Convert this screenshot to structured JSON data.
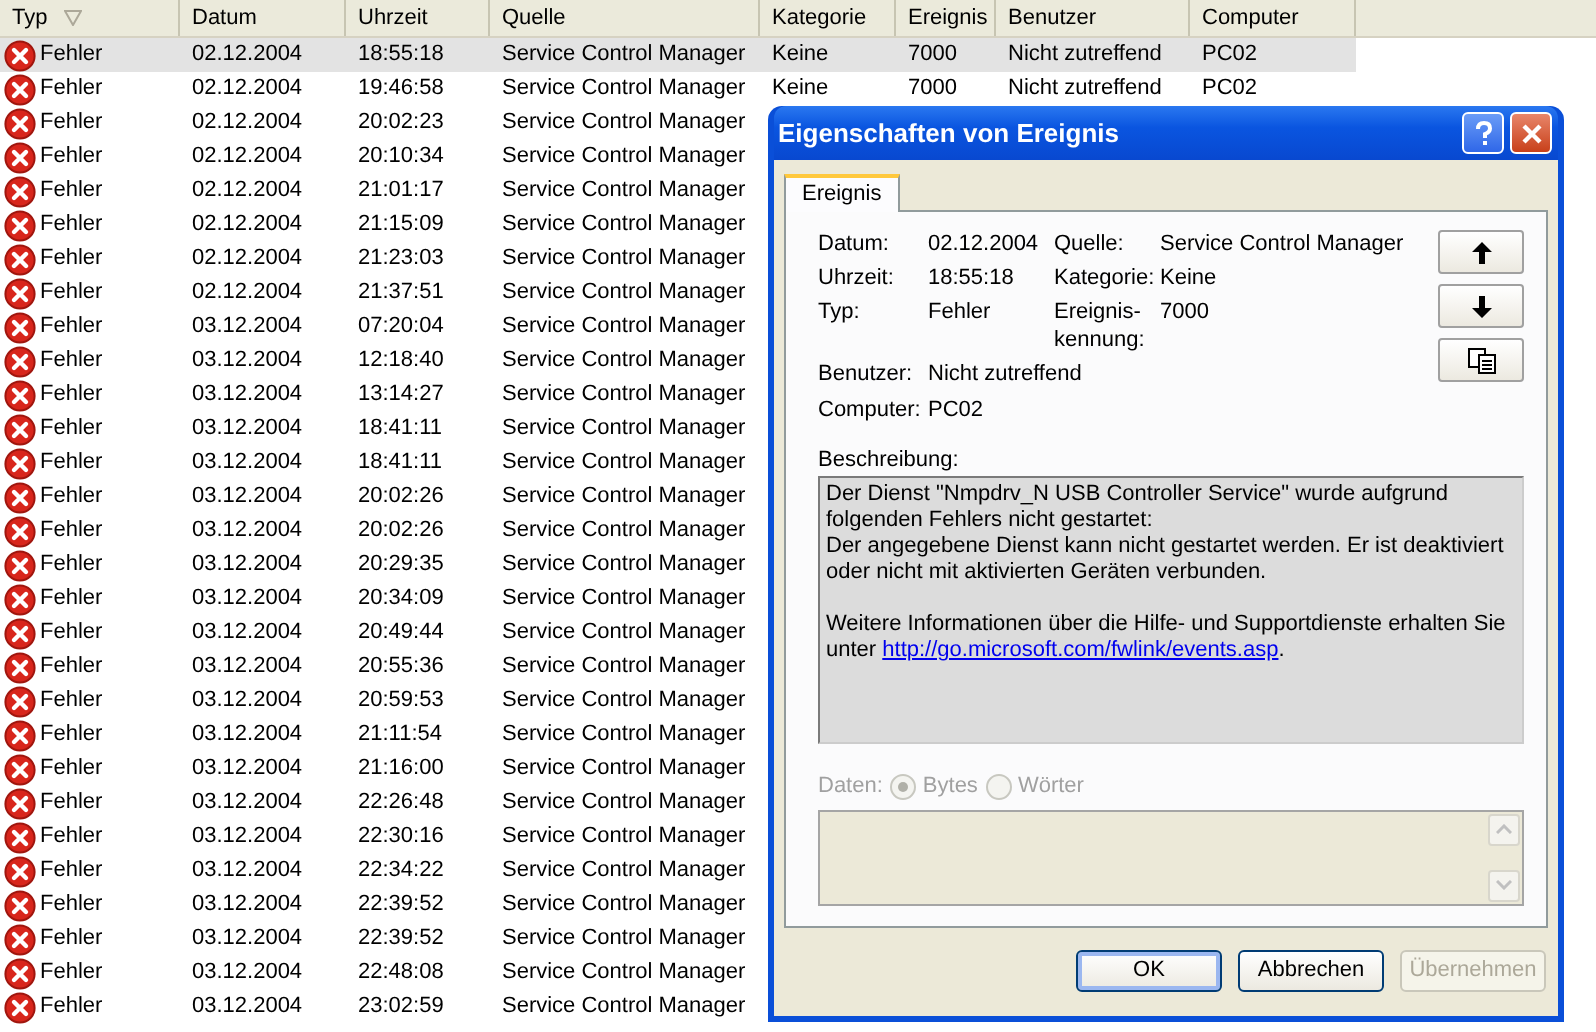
{
  "list": {
    "columns": [
      {
        "label": "Typ",
        "sorted": true
      },
      {
        "label": "Datum",
        "sorted": false
      },
      {
        "label": "Uhrzeit",
        "sorted": false
      },
      {
        "label": "Quelle",
        "sorted": false
      },
      {
        "label": "Kategorie",
        "sorted": false
      },
      {
        "label": "Ereignis",
        "sorted": false
      },
      {
        "label": "Benutzer",
        "sorted": false
      },
      {
        "label": "Computer",
        "sorted": false
      }
    ],
    "rows": [
      {
        "kind": "error",
        "selected": true,
        "cells": [
          "Fehler",
          "02.12.2004",
          "18:55:18",
          "Service Control Manager",
          "Keine",
          "7000",
          "Nicht zutreffend",
          "PC02"
        ]
      },
      {
        "kind": "error",
        "selected": false,
        "cells": [
          "Fehler",
          "02.12.2004",
          "19:46:58",
          "Service Control Manager",
          "Keine",
          "7000",
          "Nicht zutreffend",
          "PC02"
        ]
      },
      {
        "kind": "error",
        "selected": false,
        "cells": [
          "Fehler",
          "02.12.2004",
          "20:02:23",
          "Service Control Manager"
        ]
      },
      {
        "kind": "error",
        "selected": false,
        "cells": [
          "Fehler",
          "02.12.2004",
          "20:10:34",
          "Service Control Manager"
        ]
      },
      {
        "kind": "error",
        "selected": false,
        "cells": [
          "Fehler",
          "02.12.2004",
          "21:01:17",
          "Service Control Manager"
        ]
      },
      {
        "kind": "error",
        "selected": false,
        "cells": [
          "Fehler",
          "02.12.2004",
          "21:15:09",
          "Service Control Manager"
        ]
      },
      {
        "kind": "error",
        "selected": false,
        "cells": [
          "Fehler",
          "02.12.2004",
          "21:23:03",
          "Service Control Manager"
        ]
      },
      {
        "kind": "error",
        "selected": false,
        "cells": [
          "Fehler",
          "02.12.2004",
          "21:37:51",
          "Service Control Manager"
        ]
      },
      {
        "kind": "error",
        "selected": false,
        "cells": [
          "Fehler",
          "03.12.2004",
          "07:20:04",
          "Service Control Manager"
        ]
      },
      {
        "kind": "error",
        "selected": false,
        "cells": [
          "Fehler",
          "03.12.2004",
          "12:18:40",
          "Service Control Manager"
        ]
      },
      {
        "kind": "error",
        "selected": false,
        "cells": [
          "Fehler",
          "03.12.2004",
          "13:14:27",
          "Service Control Manager"
        ]
      },
      {
        "kind": "error",
        "selected": false,
        "cells": [
          "Fehler",
          "03.12.2004",
          "18:41:11",
          "Service Control Manager"
        ]
      },
      {
        "kind": "error",
        "selected": false,
        "cells": [
          "Fehler",
          "03.12.2004",
          "18:41:11",
          "Service Control Manager"
        ]
      },
      {
        "kind": "error",
        "selected": false,
        "cells": [
          "Fehler",
          "03.12.2004",
          "20:02:26",
          "Service Control Manager"
        ]
      },
      {
        "kind": "error",
        "selected": false,
        "cells": [
          "Fehler",
          "03.12.2004",
          "20:02:26",
          "Service Control Manager"
        ]
      },
      {
        "kind": "error",
        "selected": false,
        "cells": [
          "Fehler",
          "03.12.2004",
          "20:29:35",
          "Service Control Manager"
        ]
      },
      {
        "kind": "error",
        "selected": false,
        "cells": [
          "Fehler",
          "03.12.2004",
          "20:34:09",
          "Service Control Manager"
        ]
      },
      {
        "kind": "error",
        "selected": false,
        "cells": [
          "Fehler",
          "03.12.2004",
          "20:49:44",
          "Service Control Manager"
        ]
      },
      {
        "kind": "error",
        "selected": false,
        "cells": [
          "Fehler",
          "03.12.2004",
          "20:55:36",
          "Service Control Manager"
        ]
      },
      {
        "kind": "error",
        "selected": false,
        "cells": [
          "Fehler",
          "03.12.2004",
          "20:59:53",
          "Service Control Manager"
        ]
      },
      {
        "kind": "error",
        "selected": false,
        "cells": [
          "Fehler",
          "03.12.2004",
          "21:11:54",
          "Service Control Manager"
        ]
      },
      {
        "kind": "error",
        "selected": false,
        "cells": [
          "Fehler",
          "03.12.2004",
          "21:16:00",
          "Service Control Manager"
        ]
      },
      {
        "kind": "error",
        "selected": false,
        "cells": [
          "Fehler",
          "03.12.2004",
          "22:26:48",
          "Service Control Manager"
        ]
      },
      {
        "kind": "error",
        "selected": false,
        "cells": [
          "Fehler",
          "03.12.2004",
          "22:30:16",
          "Service Control Manager"
        ]
      },
      {
        "kind": "error",
        "selected": false,
        "cells": [
          "Fehler",
          "03.12.2004",
          "22:34:22",
          "Service Control Manager"
        ]
      },
      {
        "kind": "error",
        "selected": false,
        "cells": [
          "Fehler",
          "03.12.2004",
          "22:39:52",
          "Service Control Manager"
        ]
      },
      {
        "kind": "error",
        "selected": false,
        "cells": [
          "Fehler",
          "03.12.2004",
          "22:39:52",
          "Service Control Manager"
        ]
      },
      {
        "kind": "error",
        "selected": false,
        "cells": [
          "Fehler",
          "03.12.2004",
          "22:48:08",
          "Service Control Manager"
        ]
      },
      {
        "kind": "error",
        "selected": false,
        "cells": [
          "Fehler",
          "03.12.2004",
          "23:02:59",
          "Service Control Manager"
        ]
      }
    ]
  },
  "dialog": {
    "title": "Eigenschaften von Ereignis",
    "tabs": [
      {
        "label": "Ereignis",
        "selected": true
      }
    ],
    "event_fields": [
      {
        "label": "Datum:",
        "value": "02.12.2004"
      },
      {
        "label": "Quelle:",
        "value": "Service Control Manager"
      },
      {
        "label": "Uhrzeit:",
        "value": "18:55:18"
      },
      {
        "label": "Kategorie:",
        "value": "Keine"
      },
      {
        "label": "Typ:",
        "value": "Fehler"
      },
      {
        "label": "Ereignis-kennung:",
        "value": "7000"
      }
    ],
    "origin_fields": [
      {
        "label": "Benutzer:",
        "value": "Nicht zutreffend"
      },
      {
        "label": "Computer:",
        "value": "PC02"
      }
    ],
    "nav_buttons": [
      {
        "kind": "up"
      },
      {
        "kind": "down"
      },
      {
        "kind": "copy"
      }
    ],
    "description": {
      "label": "Beschreibung:",
      "paragraphs": [
        "Der Dienst \"Nmpdrv_N USB Controller Service\" wurde aufgrund folgenden Fehlers nicht gestartet:",
        "Der angegebene Dienst kann nicht gestartet werden. Er ist deaktiviert oder nicht mit aktivierten Geräten verbunden."
      ],
      "more_info": {
        "text": "Weitere Informationen über die Hilfe- und Supportdienste erhalten Sie unter",
        "link": "http://go.microsoft.com/fwlink/events.asp",
        "after": "."
      }
    },
    "data": {
      "label": "Daten:",
      "disabled": true,
      "options": [
        {
          "label": "Bytes",
          "selected": true
        },
        {
          "label": "Wörter",
          "selected": false
        }
      ]
    },
    "buttons": [
      {
        "label": "OK",
        "default": true,
        "disabled": false
      },
      {
        "label": "Abbrechen",
        "default": false,
        "disabled": false
      },
      {
        "label": "Übernehmen",
        "default": false,
        "disabled": true
      }
    ]
  }
}
